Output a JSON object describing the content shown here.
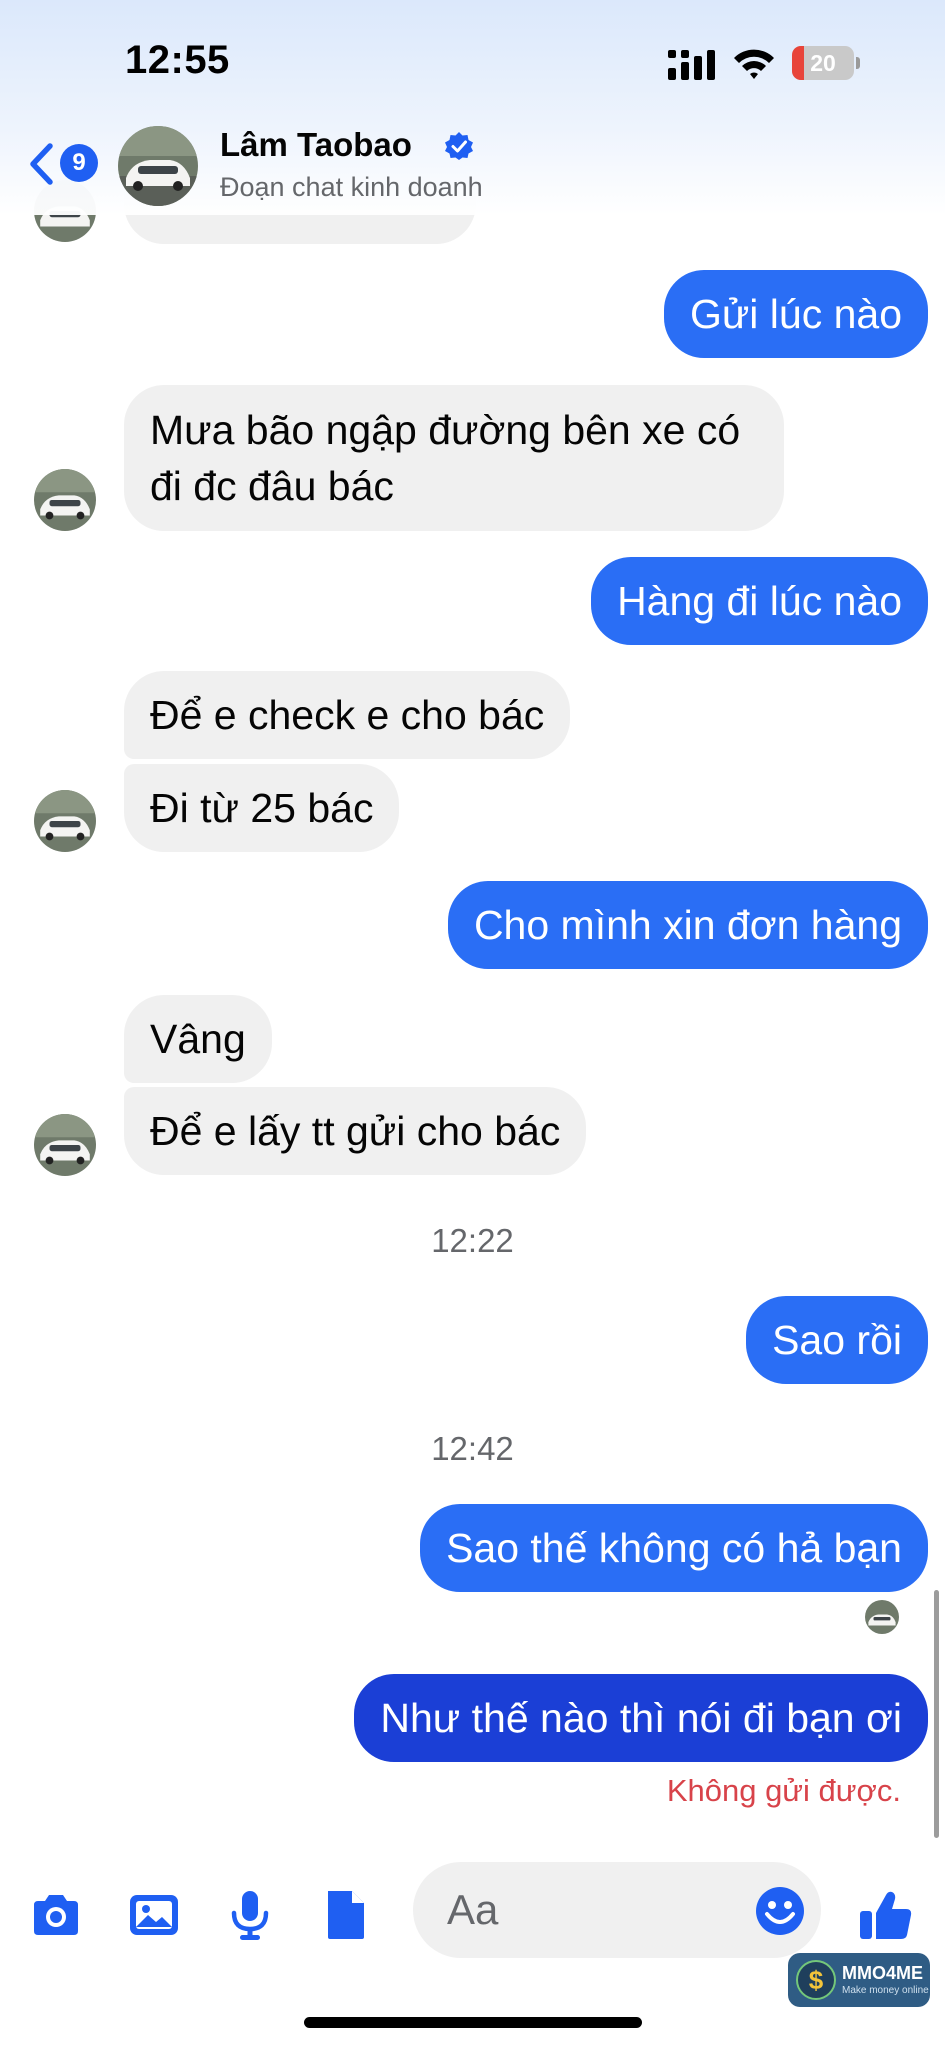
{
  "status_bar": {
    "time": "12:55",
    "battery": "20",
    "battery_level": 0.2
  },
  "header": {
    "back_badge_count": "9",
    "contact_name": "Lâm Taobao",
    "contact_subtitle": "Đoạn chat kinh doanh"
  },
  "messages": [
    {
      "from": "me",
      "text": "Gửi lúc nào"
    },
    {
      "from": "contact",
      "text": "Mưa bão ngập đường bên xe có đi đc đâu bác"
    },
    {
      "from": "me",
      "text": "Hàng đi lúc nào"
    },
    {
      "from": "contact",
      "text": "Để e check e cho bác"
    },
    {
      "from": "contact",
      "text": "Đi từ 25 bác"
    },
    {
      "from": "me",
      "text": "Cho mình xin đơn hàng"
    },
    {
      "from": "contact",
      "text": "Vâng"
    },
    {
      "from": "contact",
      "text": "Để e lấy tt gửi cho bác"
    },
    {
      "from": "me",
      "text": "Sao rồi"
    },
    {
      "from": "me",
      "text": "Sao thế không có hả bạn"
    },
    {
      "from": "me",
      "text": "Như thế nào thì nói đi bạn ơi",
      "status": "failed"
    }
  ],
  "timestamps": [
    "12:22",
    "12:42"
  ],
  "failed_notice": "Không gửi được.",
  "composer": {
    "placeholder": "Aa"
  },
  "watermark": {
    "title": "MMO4ME",
    "subtitle": "Make money online"
  },
  "colors": {
    "outgoing": "#2a6ef5",
    "outgoing_failed": "#1b3fd6",
    "incoming": "#f0f0f0",
    "accent": "#1f5ff2",
    "error": "#d8434a"
  },
  "icons": [
    "back-chevron-icon",
    "verified-badge-icon",
    "camera-icon",
    "gallery-icon",
    "microphone-icon",
    "document-icon",
    "emoji-icon",
    "thumbs-up-icon"
  ]
}
